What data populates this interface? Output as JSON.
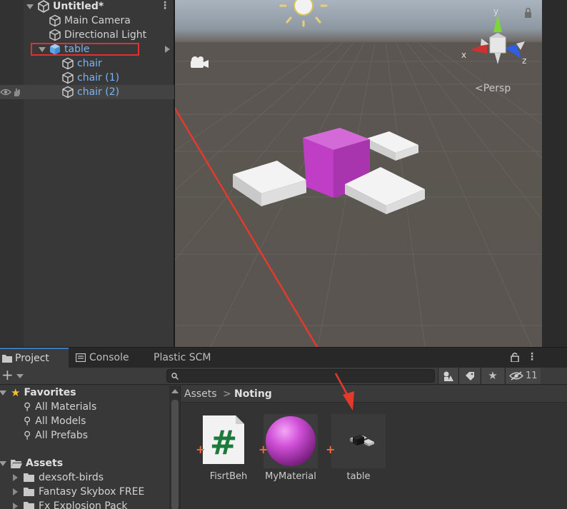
{
  "hierarchy": {
    "scene_name": "Untitled*",
    "items": [
      {
        "label": "Main Camera",
        "color": "white"
      },
      {
        "label": "Directional Light",
        "color": "white"
      },
      {
        "label": "table",
        "color": "blue"
      },
      {
        "label": "chair",
        "color": "blue"
      },
      {
        "label": "chair (1)",
        "color": "blue"
      },
      {
        "label": "chair (2)",
        "color": "blue"
      }
    ]
  },
  "scene": {
    "projection_label": "<Persp",
    "gizmo_axes": {
      "x": "x",
      "y": "y",
      "z": "z"
    },
    "colors": {
      "cube": "#c440c8",
      "axis_x": "#d03030",
      "axis_y": "#7fd43a",
      "axis_z": "#2f5fe0",
      "arrow": "#e33a2c"
    }
  },
  "project": {
    "tabs": [
      "Project",
      "Console",
      "Plastic SCM"
    ],
    "hidden_count": "11",
    "tree": {
      "favorites": "Favorites",
      "favorite_items": [
        "All Materials",
        "All Models",
        "All Prefabs"
      ],
      "assets": "Assets",
      "asset_items": [
        "dexsoft-birds",
        "Fantasy Skybox FREE",
        "Fx Explosion Pack"
      ]
    },
    "breadcrumb": {
      "root": "Assets",
      "current": "Noting"
    },
    "assets": [
      {
        "name": "FisrtBeh",
        "icon": "csharp-script-icon"
      },
      {
        "name": "MyMaterial",
        "icon": "material-sphere-icon"
      },
      {
        "name": "table",
        "icon": "prefab-icon"
      }
    ]
  }
}
